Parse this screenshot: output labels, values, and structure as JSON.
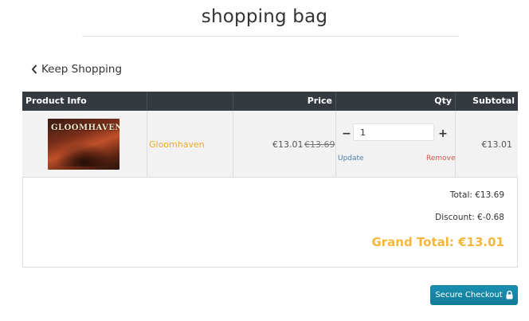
{
  "header": {
    "title": "shopping bag"
  },
  "nav": {
    "keep_shopping": "Keep Shopping"
  },
  "table": {
    "columns": {
      "product_info": "Product Info",
      "price": "Price",
      "qty": "Qty",
      "subtotal": "Subtotal"
    },
    "items": [
      {
        "image_logo_text": "GLOOMHAVEN",
        "name": "Gloomhaven",
        "price_current": "€13.01",
        "price_original": "€13.69",
        "quantity": "1",
        "minus": "−",
        "plus": "+",
        "update_label": "Update",
        "remove_label": "Remove",
        "subtotal": "€13.01"
      }
    ]
  },
  "totals": {
    "total": "Total: €13.69",
    "discount": "Discount: €-0.68",
    "grand_total": "Grand Total: €13.01"
  },
  "checkout": {
    "label": "Secure Checkout"
  },
  "colors": {
    "header_bg": "#343a40",
    "accent_orange": "#f0a82a",
    "grand_total": "#f5b73a",
    "checkout_bg": "#17a2b8",
    "remove": "#d9534f",
    "update": "#4a7ea8"
  },
  "icons": {
    "back": "chevron-left-icon",
    "lock": "lock-icon"
  }
}
